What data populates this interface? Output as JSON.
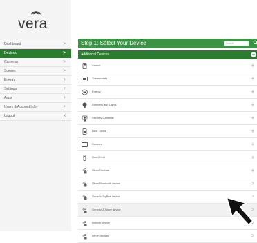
{
  "brand": {
    "logo_text": "vera"
  },
  "sidebar": {
    "items": [
      {
        "label": "Dashboard",
        "indicator": ">",
        "active": false
      },
      {
        "label": "Devices",
        "indicator": ">",
        "active": true
      },
      {
        "label": "Cameras",
        "indicator": ">",
        "active": false
      },
      {
        "label": "Scenes",
        "indicator": ">",
        "active": false
      },
      {
        "label": "Energy",
        "indicator": "+",
        "active": false
      },
      {
        "label": "Settings",
        "indicator": "+",
        "active": false
      },
      {
        "label": "Apps",
        "indicator": "+",
        "active": false
      },
      {
        "label": "Users & Account Info",
        "indicator": "+",
        "active": false
      },
      {
        "label": "Logout",
        "indicator": "x",
        "active": false
      }
    ]
  },
  "main": {
    "step_title": "Step 1: Select Your Device",
    "search_placeholder": "Search",
    "section_title": "Additional Devices",
    "devices": [
      {
        "label": "Alarms",
        "icon": "alarm-panel-icon",
        "action": "+"
      },
      {
        "label": "Thermostats",
        "icon": "thermostat-icon",
        "action": "+"
      },
      {
        "label": "Energy",
        "icon": "energy-meter-icon",
        "action": "+"
      },
      {
        "label": "Dimmers and Lights",
        "icon": "light-bulb-icon",
        "action": "+"
      },
      {
        "label": "Security Cameras",
        "icon": "camera-icon",
        "action": "+"
      },
      {
        "label": "Door Locks",
        "icon": "door-lock-icon",
        "action": "+"
      },
      {
        "label": "Sensors",
        "icon": "sensor-icon",
        "action": "+"
      },
      {
        "label": "Hand Held",
        "icon": "remote-icon",
        "action": "+"
      },
      {
        "label": "Other Devices",
        "icon": "wireless-icon",
        "action": "+"
      },
      {
        "label": "Other Bluetooth device",
        "icon": "wireless-icon",
        "action": ">"
      },
      {
        "label": "Generic ZigBee device",
        "icon": "wireless-icon",
        "action": ">"
      },
      {
        "label": "Generic Z-Wave device",
        "icon": "wireless-icon",
        "action": ">"
      },
      {
        "label": "Insteon device",
        "icon": "wireless-icon",
        "action": ">"
      },
      {
        "label": "UPnP devices",
        "icon": "wireless-icon",
        "action": ">"
      }
    ]
  },
  "colors": {
    "accent_green": "#3b9443",
    "dark_green": "#2a7d2e",
    "sidebar_bg": "#f4f4f4"
  }
}
